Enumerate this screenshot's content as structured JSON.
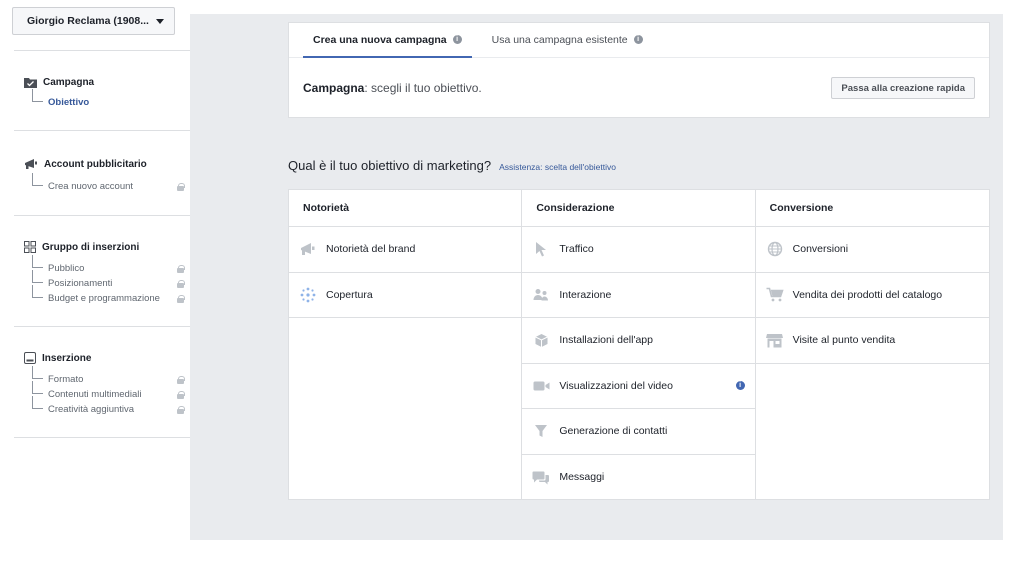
{
  "account_selector": {
    "label": "Giorgio Reclama (1908..."
  },
  "sidebar": {
    "campaign": {
      "title": "Campagna",
      "items": [
        {
          "label": "Obiettivo"
        }
      ]
    },
    "ad_account": {
      "title": "Account pubblicitario",
      "items": [
        {
          "label": "Crea nuovo account"
        }
      ]
    },
    "ad_set": {
      "title": "Gruppo di inserzioni",
      "items": [
        {
          "label": "Pubblico"
        },
        {
          "label": "Posizionamenti"
        },
        {
          "label": "Budget e programmazione"
        }
      ]
    },
    "ad": {
      "title": "Inserzione",
      "items": [
        {
          "label": "Formato"
        },
        {
          "label": "Contenuti multimediali"
        },
        {
          "label": "Creatività aggiuntiva"
        }
      ]
    }
  },
  "tabs": [
    {
      "label": "Crea una nuova campagna"
    },
    {
      "label": "Usa una campagna esistente"
    }
  ],
  "campaign_row": {
    "label": "Campagna",
    "text": ": scegli il tuo obiettivo.",
    "quick_button": "Passa alla creazione rapida"
  },
  "objective_heading": {
    "title": "Qual è il tuo obiettivo di marketing?",
    "help_link": "Assistenza: scelta dell'obiettivo"
  },
  "columns": [
    {
      "title": "Notorietà",
      "items": [
        {
          "label": "Notorietà del brand",
          "icon": "megaphone-icon"
        },
        {
          "label": "Copertura",
          "icon": "reach-icon"
        }
      ]
    },
    {
      "title": "Considerazione",
      "items": [
        {
          "label": "Traffico",
          "icon": "cursor-icon"
        },
        {
          "label": "Interazione",
          "icon": "people-icon"
        },
        {
          "label": "Installazioni dell'app",
          "icon": "box-icon"
        },
        {
          "label": "Visualizzazioni del video",
          "icon": "video-camera-icon"
        },
        {
          "label": "Generazione di contatti",
          "icon": "funnel-icon"
        },
        {
          "label": "Messaggi",
          "icon": "chat-icon"
        }
      ]
    },
    {
      "title": "Conversione",
      "items": [
        {
          "label": "Conversioni",
          "icon": "globe-icon"
        },
        {
          "label": "Vendita dei prodotti del catalogo",
          "icon": "cart-icon"
        },
        {
          "label": "Visite al punto vendita",
          "icon": "store-icon"
        }
      ]
    }
  ],
  "colors": {
    "accent": "#4267b2",
    "link": "#365899",
    "background": "#e9ebee"
  }
}
